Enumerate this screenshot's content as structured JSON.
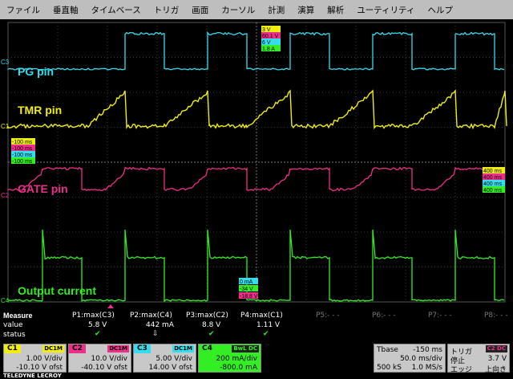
{
  "menu": [
    "ファイル",
    "垂直軸",
    "タイムベース",
    "トリガ",
    "画面",
    "カーソル",
    "計測",
    "演算",
    "解析",
    "ユーティリティ",
    "ヘルプ"
  ],
  "channels": {
    "c3": {
      "label": "PG pin",
      "marker": "C3",
      "color": "#33ddee"
    },
    "c1": {
      "label": "TMR pin",
      "marker": "C1",
      "color": "#f0ee10"
    },
    "c2": {
      "label": "GATE pin",
      "marker": "C2",
      "color": "#ee2f8a"
    },
    "c4": {
      "label": "Output current",
      "marker": "C4",
      "color": "#33ee22"
    }
  },
  "readouts": {
    "top": [
      "3 V",
      "60.1 V",
      "6 V",
      "1.8 A"
    ],
    "left": [
      "-100 ms",
      "-100 ms",
      "-100 ms",
      "-100 ms"
    ],
    "right": [
      "400 ms",
      "400 ms",
      "400 ms",
      "400 ms"
    ],
    "bottom": [
      "0 mA",
      "-34 V",
      "-18.8 V"
    ]
  },
  "measure": {
    "title": "Measure",
    "row2": "value",
    "row3": "status",
    "p": [
      {
        "name": "P1:max(C3)",
        "value": "5.8 V"
      },
      {
        "name": "P2:max(C4)",
        "value": "442 mA"
      },
      {
        "name": "P3:max(C2)",
        "value": "8.8 V"
      },
      {
        "name": "P4:max(C1)",
        "value": "1.11 V"
      },
      {
        "name": "P5:- - -",
        "value": ""
      },
      {
        "name": "P6:- - -",
        "value": ""
      },
      {
        "name": "P7:- - -",
        "value": ""
      },
      {
        "name": "P8:- - -",
        "value": ""
      }
    ]
  },
  "chanbar": [
    {
      "tag": "C1",
      "cpl": "DC1M",
      "v1": "1.00 V/div",
      "v2": "-10.10 V ofst",
      "bg": "#f0ee10"
    },
    {
      "tag": "C2",
      "cpl": "DC1M",
      "v1": "10.0 V/div",
      "v2": "-40.10 V ofst",
      "bg": "#ee2f8a"
    },
    {
      "tag": "C3",
      "cpl": "DC1M",
      "v1": "5.00 V/div",
      "v2": "14.00 V ofst",
      "bg": "#33ddee"
    },
    {
      "tag": "C4",
      "cpl": "BwL DC",
      "v1": "200 mA/div",
      "v2": "-800.0 mA",
      "bg": "#33ee22"
    }
  ],
  "timebase": {
    "label": "Tbase",
    "delay": "-150 ms",
    "div": "50.0 ms/div",
    "samples": "500 kS",
    "rate": "1.0 MS/s"
  },
  "trigger": {
    "label": "トリガ",
    "tag": "C2",
    "cpl": "DC",
    "mode": "停止",
    "level": "3.7 V",
    "type": "エッジ",
    "slope": "上向き"
  },
  "brand": "TELEDYNE LECROY"
}
